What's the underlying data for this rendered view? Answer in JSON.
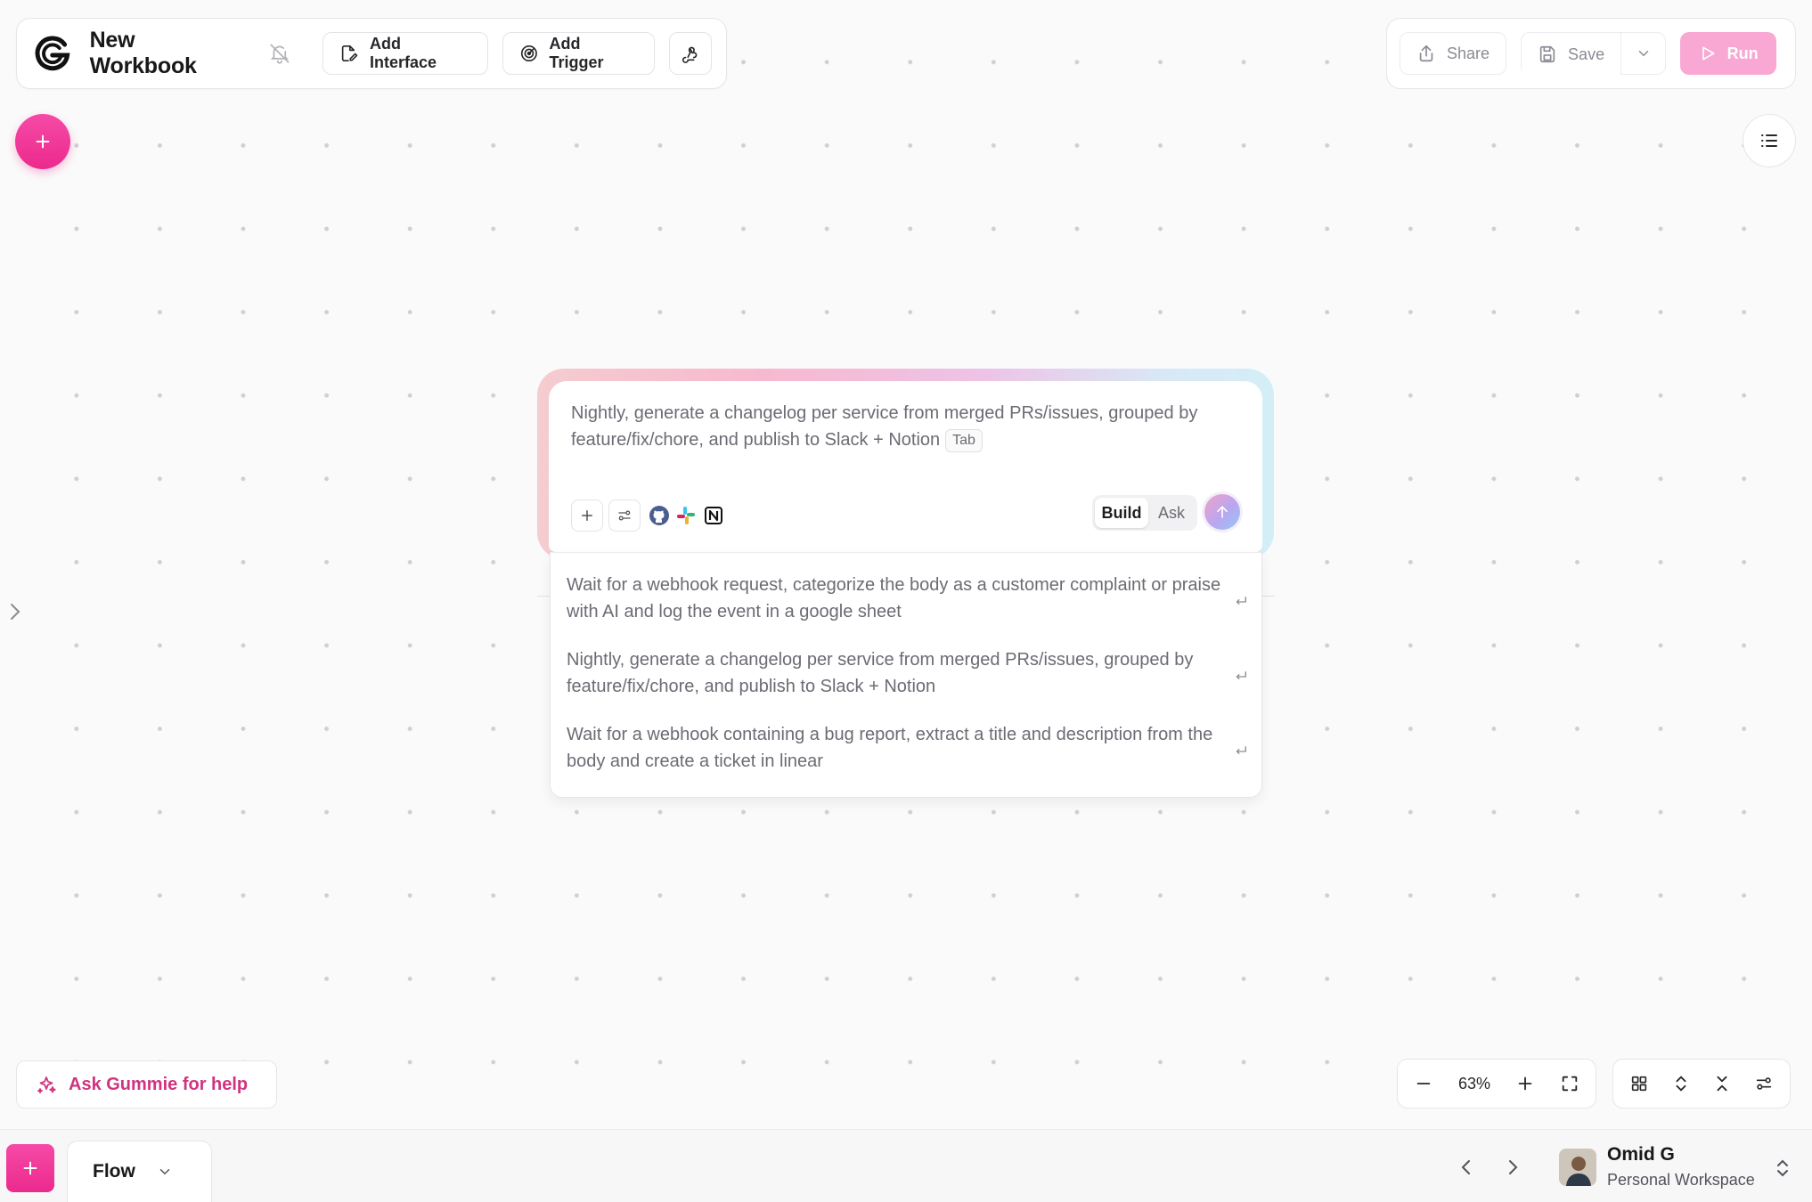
{
  "header": {
    "title": "New Workbook",
    "add_interface": "Add Interface",
    "add_trigger": "Add Trigger",
    "share": "Share",
    "save": "Save",
    "run": "Run"
  },
  "prompt": {
    "text": "Nightly, generate a changelog per service from merged PRs/issues, grouped by feature/fix/chore, and publish to Slack + Notion",
    "tab_hint": "Tab",
    "mode_build": "Build",
    "mode_ask": "Ask",
    "integrations": [
      "github-icon",
      "slack-icon",
      "notion-icon"
    ]
  },
  "suggestions": [
    "Wait for a webhook request, categorize the body as a customer complaint or praise with AI and log the event in a google sheet",
    "Nightly, generate a changelog per service from merged PRs/issues, grouped by feature/fix/chore, and publish to Slack + Notion",
    "Wait for a webhook containing a bug report, extract a title and description from the body and create a ticket in linear"
  ],
  "helper": {
    "ask_label": "Ask Gummie for help"
  },
  "zoom": {
    "level": "63%"
  },
  "bottom": {
    "flow_tab": "Flow",
    "user_name": "Omid G",
    "workspace": "Personal Workspace"
  },
  "colors": {
    "accent": "#ec2a8d",
    "run_disabled": "#f9a8d4",
    "helper_text": "#d0337f"
  }
}
